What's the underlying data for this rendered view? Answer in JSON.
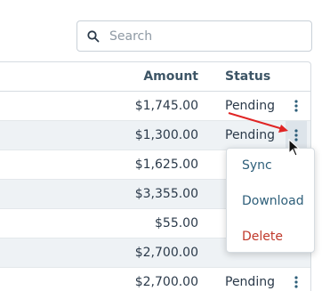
{
  "search": {
    "placeholder": "Search",
    "icon": "search-icon"
  },
  "table": {
    "columns": {
      "amount": "Amount",
      "status": "Status"
    },
    "rows": [
      {
        "amount": "$1,745.00",
        "status": "Pending"
      },
      {
        "amount": "$1,300.00",
        "status": "Pending"
      },
      {
        "amount": "$1,625.00",
        "status": ""
      },
      {
        "amount": "$3,355.00",
        "status": ""
      },
      {
        "amount": "$55.00",
        "status": ""
      },
      {
        "amount": "$2,700.00",
        "status": ""
      },
      {
        "amount": "$2,700.00",
        "status": "Pending"
      }
    ]
  },
  "menu": {
    "items": [
      {
        "label": "Sync"
      },
      {
        "label": "Download"
      },
      {
        "label": "Delete"
      }
    ]
  },
  "colors": {
    "accent": "#2e5f7a",
    "danger": "#c0392b",
    "annotation_arrow": "#e02424",
    "row_shade": "#eef2f5"
  }
}
